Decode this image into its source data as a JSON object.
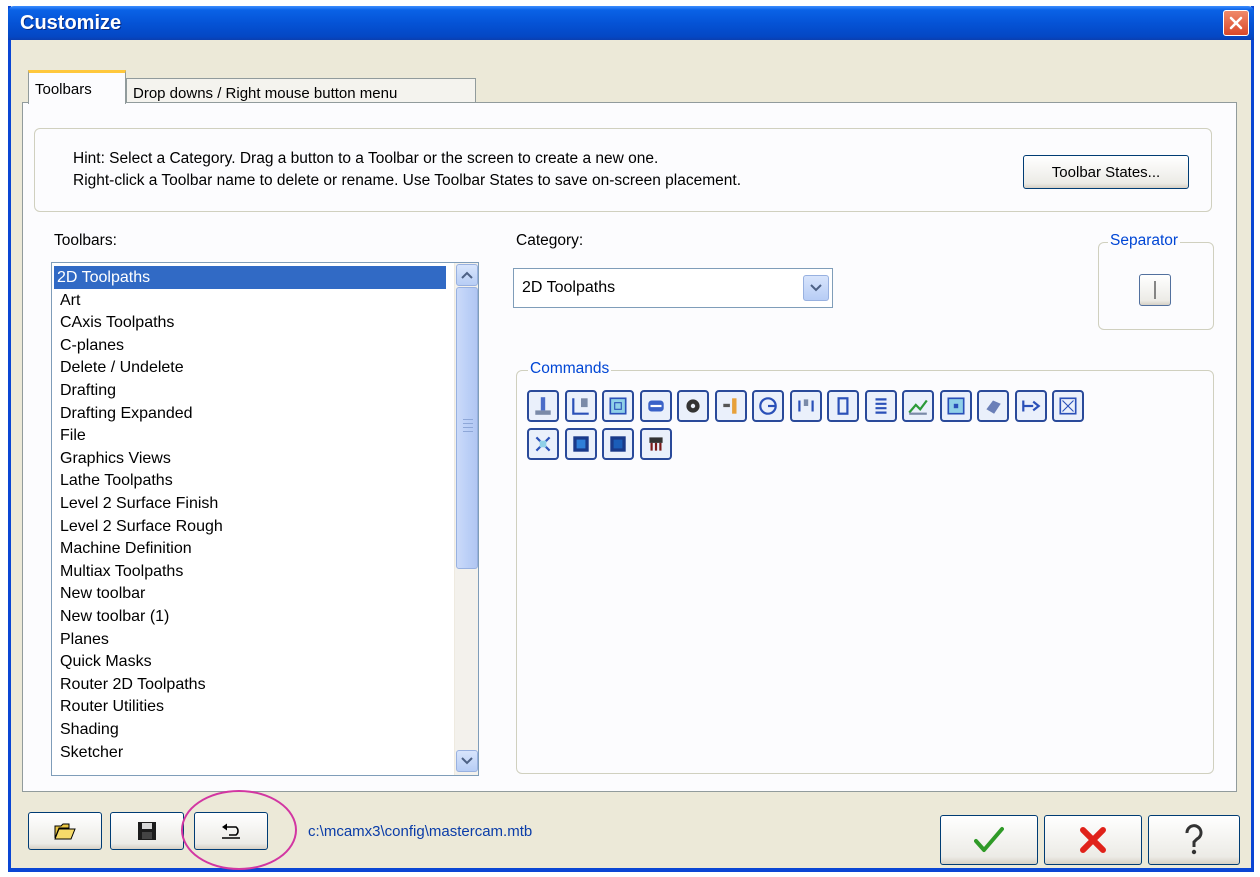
{
  "window": {
    "title": "Customize",
    "close_icon": "close-icon"
  },
  "tabs": [
    {
      "label": "Toolbars",
      "active": true
    },
    {
      "label": "Drop downs / Right mouse button menu",
      "active": false
    }
  ],
  "hint": {
    "line1": "Hint:  Select a Category.  Drag a button to a Toolbar or the screen to create a new one.",
    "line2": "Right-click a Toolbar name to delete or rename.  Use Toolbar States to save on-screen placement.",
    "toolbar_states_label": "Toolbar States..."
  },
  "toolbars_list": {
    "label": "Toolbars:",
    "selected": "2D Toolpaths",
    "items": [
      "2D Toolpaths",
      "Art",
      "CAxis Toolpaths",
      "C-planes",
      "Delete / Undelete",
      "Drafting",
      "Drafting Expanded",
      "File",
      "Graphics Views",
      "Lathe Toolpaths",
      "Level 2 Surface Finish",
      "Level 2 Surface Rough",
      "Machine Definition",
      "Multiax Toolpaths",
      "New toolbar",
      "New toolbar (1)",
      "Planes",
      "Quick Masks",
      "Router 2D Toolpaths",
      "Router Utilities",
      "Shading",
      "Sketcher"
    ]
  },
  "category": {
    "label": "Category:",
    "value": "2D Toolpaths"
  },
  "separator": {
    "label": "Separator"
  },
  "commands": {
    "label": "Commands",
    "icons": [
      "facing-icon",
      "contour-icon",
      "pocket-icon",
      "slot-icon",
      "gear-icon",
      "drill-icon",
      "circle-mill-icon",
      "transform-icon",
      "bracket-icon",
      "thread-mill-icon",
      "surface-toolpath-icon",
      "pocket-island-icon",
      "solid-icon",
      "trim-extend-icon",
      "chain-icon",
      "engrave-icon",
      "block-icon",
      "block-alt-icon",
      "tool-manager-icon"
    ]
  },
  "footer": {
    "path": "c:\\mcamx3\\config\\mastercam.mtb",
    "open_icon": "open-folder-icon",
    "save_icon": "save-icon",
    "reset_icon": "undo-icon",
    "ok_icon": "checkmark-icon",
    "cancel_icon": "cancel-x-icon",
    "help_icon": "help-icon"
  }
}
